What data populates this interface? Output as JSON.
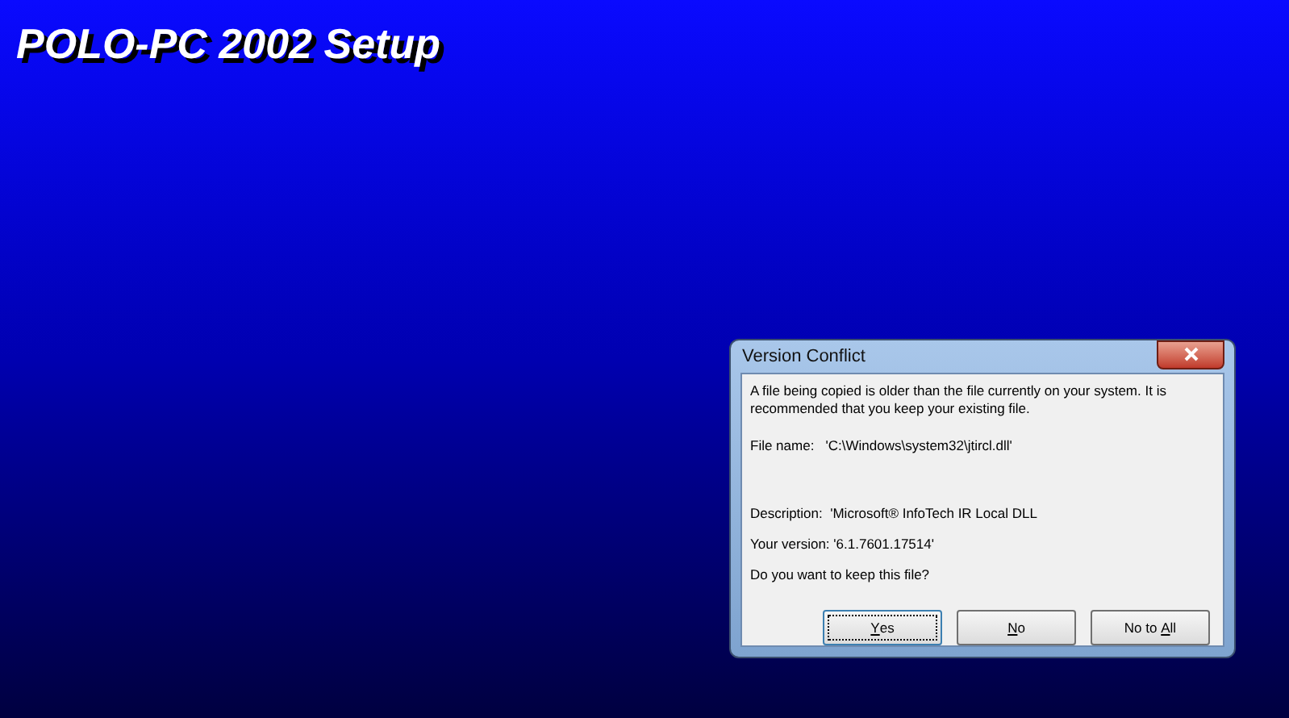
{
  "title": "POLO-PC 2002 Setup",
  "dialog": {
    "title": "Version Conflict",
    "message": "A file being copied is older than the file currently on your system.  It is recommended that you keep your existing file.",
    "file_name": "File name:   'C:\\Windows\\system32\\jtircl.dll'",
    "description": "Description:  'Microsoft® InfoTech IR Local DLL",
    "version": "Your version: '6.1.7601.17514'",
    "question": "Do you want to keep this file?",
    "buttons": [
      {
        "key": "Y",
        "post": "es",
        "focused": true
      },
      {
        "key": "N",
        "post": "o",
        "focused": false
      },
      {
        "pre": "No to ",
        "key": "A",
        "post": "ll",
        "focused": false
      }
    ]
  }
}
